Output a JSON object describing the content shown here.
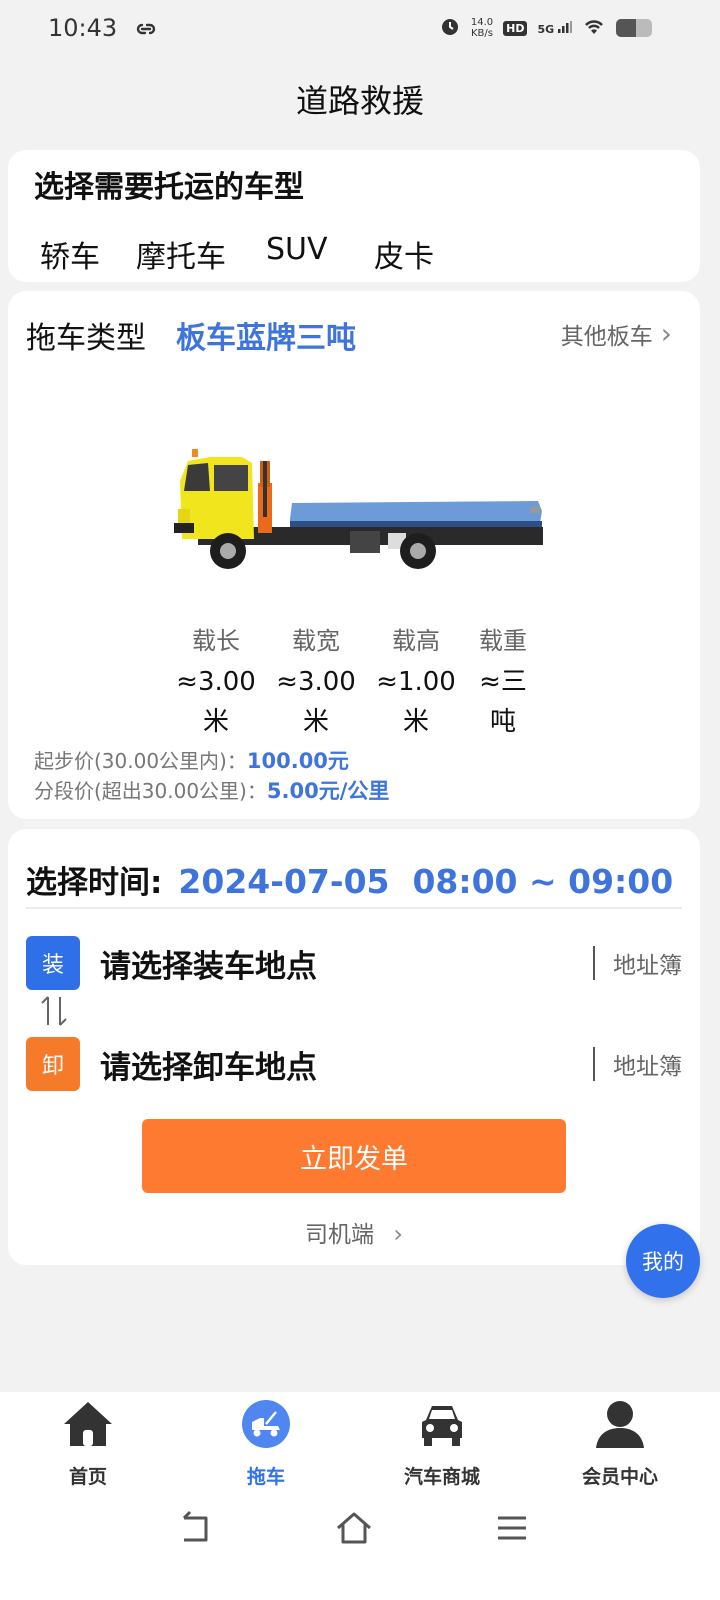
{
  "status_bar": {
    "time": "10:43",
    "speed_value": "14.0",
    "speed_unit": "KB/s",
    "hd": "HD",
    "network": "5G"
  },
  "header": {
    "title": "道路救援"
  },
  "vehicle_type": {
    "heading": "选择需要托运的车型",
    "options": [
      "轿车",
      "摩托车",
      "SUV",
      "皮卡"
    ]
  },
  "tow_truck": {
    "label": "拖车类型",
    "value": "板车蓝牌三吨",
    "other_link": "其他板车",
    "specs": [
      {
        "label": "载长",
        "value": "≈3.00米"
      },
      {
        "label": "载宽",
        "value": "≈3.00米"
      },
      {
        "label": "载高",
        "value": "≈1.00米"
      },
      {
        "label": "载重",
        "value": "≈三吨"
      }
    ],
    "start_price_label": "起步价(30.00公里内)：",
    "start_price_value": "100.00元",
    "segment_price_label": "分段价(超出30.00公里)：",
    "segment_price_value": "5.00元/公里"
  },
  "order": {
    "time_label": "选择时间:",
    "time_value": "2024-07-05  08:00 ~ 09:00",
    "load_badge": "装",
    "load_placeholder": "请选择装车地点",
    "unload_badge": "卸",
    "unload_placeholder": "请选择卸车地点",
    "address_book": "地址簿",
    "submit": "立即发单",
    "driver_link": "司机端"
  },
  "fab": {
    "label": "我的"
  },
  "bottom_nav": [
    {
      "label": "首页",
      "icon": "home-icon"
    },
    {
      "label": "拖车",
      "icon": "tow-truck-icon",
      "active": true
    },
    {
      "label": "汽车商城",
      "icon": "car-icon"
    },
    {
      "label": "会员中心",
      "icon": "user-icon"
    }
  ],
  "colors": {
    "accent": "#3e74dc",
    "orange": "#fe7a30",
    "fab": "#3171ec"
  }
}
